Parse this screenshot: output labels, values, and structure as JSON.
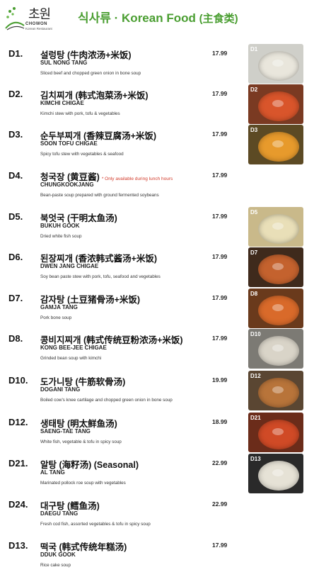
{
  "header": {
    "logo_text": "초원",
    "logo_english": "CHOWON",
    "logo_subtitle": "Korean Restaurant",
    "title_korean": "식사류",
    "title_sep": " · ",
    "title_english": "Korean Food ",
    "title_chinese": "(主食类)"
  },
  "items": [
    {
      "code": "D1.",
      "name": "설렁탕 (牛肉浓汤+米饭)",
      "note": "",
      "roman": "SUL NONG TANG",
      "desc": "Sliced beef and chopped green onion in bone soup",
      "price": "17.99",
      "photo_label": "D1",
      "bg": "#cfcfc9",
      "food": "#e9e6dc"
    },
    {
      "code": "D2.",
      "name": "김치찌개 (韩式泡菜汤+米饭)",
      "note": "",
      "roman": "KIMCHI CHIGAE",
      "desc": "Kimchi stew with pork, tofu & vegetables",
      "price": "17.99",
      "photo_label": "D2",
      "bg": "#7a3a22",
      "food": "#d9552b"
    },
    {
      "code": "D3.",
      "name": "순두부찌개 (香辣豆腐汤+米饭)",
      "note": "",
      "roman": "SOON TOFU CHIGAE",
      "desc": "Spicy tofu stew with vegetables & seafood",
      "price": "17.99",
      "photo_label": "D3",
      "bg": "#5c4a24",
      "food": "#e79a2c"
    },
    {
      "code": "D4.",
      "name": "청국장 (黄豆酱)",
      "note": "* Only available during lunch hours",
      "roman": "CHUNGKOOKJANG",
      "desc": "Bean-paste soup prepared with ground fermented soybeans",
      "price": "17.99",
      "photo_label": "",
      "bg": "#ffffff",
      "food": "#ffffff"
    },
    {
      "code": "D5.",
      "name": "북엇국 (干明太鱼汤)",
      "note": "",
      "roman": "BUKUH GOOK",
      "desc": "Dried white fish soup",
      "price": "17.99",
      "photo_label": "D5",
      "bg": "#c9b98a",
      "food": "#e9dfb8"
    },
    {
      "code": "D6.",
      "name": "된장찌개 (香浓韩式酱汤+米饭)",
      "note": "",
      "roman": "DWEN JANG CHIGAE",
      "desc": "Soy bean paste stew with pork, tofu, seafood and vegetables",
      "price": "17.99",
      "photo_label": "D7",
      "bg": "#3f2a1c",
      "food": "#c4622e"
    },
    {
      "code": "D7.",
      "name": "감자탕 (土豆猪骨汤+米饭)",
      "note": "",
      "roman": "GAMJA TANG",
      "desc": "Pork bone soup",
      "price": "17.99",
      "photo_label": "D8",
      "bg": "#6a3a1c",
      "food": "#d96a2a"
    },
    {
      "code": "D8.",
      "name": "콩비지찌개 (韩式传统豆粉浓汤+米饭)",
      "note": "",
      "roman": "KONG BEE-JEE CHIGAE",
      "desc": "Grinded bean soup with kimchi",
      "price": "17.99",
      "photo_label": "D10",
      "bg": "#7c7a74",
      "food": "#d9d4c8"
    },
    {
      "code": "D10.",
      "name": "도가니탕 (牛筋软骨汤)",
      "note": "",
      "roman": "DOGANI TANG",
      "desc": "Boiled cow's knee cartilage and chopped green onion in bone soup",
      "price": "19.99",
      "photo_label": "D12",
      "bg": "#5a4632",
      "food": "#b8743a"
    },
    {
      "code": "D12.",
      "name": "생태탕 (明太鲜鱼汤)",
      "note": "",
      "roman": "SAENG-TAE TANG",
      "desc": "White fish, vegetable & tofu in spicy soup",
      "price": "18.99",
      "photo_label": "D21",
      "bg": "#6b2c1a",
      "food": "#d04a26"
    },
    {
      "code": "D21.",
      "name": "알탕 (海籽汤) (Seasonal)",
      "note": "",
      "roman": "AL TANG",
      "desc": "Marinated pollock roe soup with vegetables",
      "price": "22.99",
      "photo_label": "D13",
      "bg": "#2a2a2a",
      "food": "#e6e2d6"
    },
    {
      "code": "D24.",
      "name": "대구탕 (鳕鱼汤)",
      "note": "",
      "roman": "DAEGU TANG",
      "desc": "Fresh cod fish, assorted vegetables & tofu in spicy soup",
      "price": "22.99",
      "photo_label": "",
      "bg": "#ffffff",
      "food": "#ffffff"
    },
    {
      "code": "D13.",
      "name": "떡국 (韩式传统年糕汤)",
      "note": "",
      "roman": "DDUK GOOK",
      "desc": "Rice cake soup",
      "price": "17.99",
      "photo_label": "",
      "bg": "#ffffff",
      "food": "#ffffff"
    }
  ]
}
